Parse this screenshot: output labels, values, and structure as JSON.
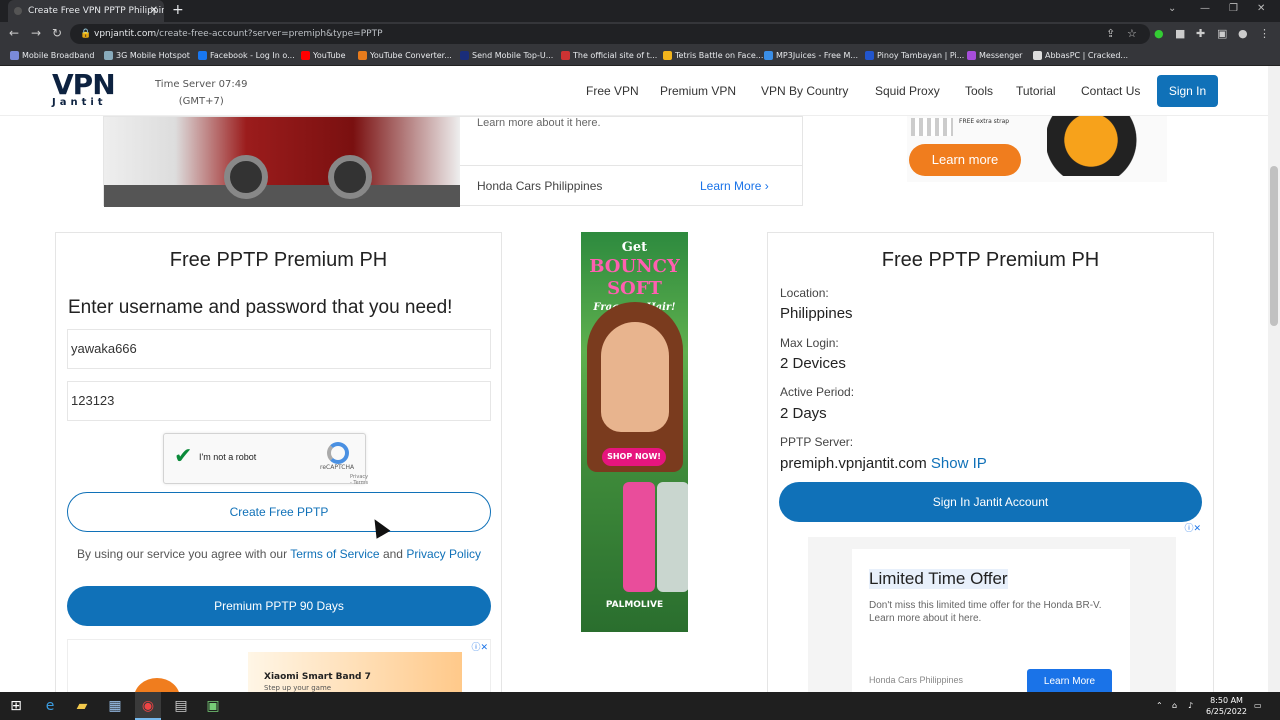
{
  "browser": {
    "tab_title": "Create Free VPN PPTP Philippine",
    "url_host": "vpnjantit.com",
    "url_path": "/create-free-account?server=premiph&type=PPTP",
    "bookmarks": [
      "Mobile Broadband",
      "3G Mobile Hotspot",
      "Facebook - Log In o...",
      "YouTube",
      "YouTube Converter...",
      "Send Mobile Top-U...",
      "The official site of t...",
      "Tetris Battle on Face...",
      "MP3Juices - Free M...",
      "Pinoy Tambayan | Pi...",
      "Messenger",
      "AbbasPC | Cracked..."
    ]
  },
  "header": {
    "logo_top": "VPN",
    "logo_bottom": "Jantit",
    "time_server": "Time Server 07:49",
    "timezone": "(GMT+7)",
    "menu": [
      "Free VPN",
      "Premium VPN",
      "VPN By Country",
      "Squid Proxy",
      "Tools",
      "Tutorial",
      "Contact Us"
    ],
    "signin": "Sign In"
  },
  "top_ad": {
    "desc": "Learn more about it here.",
    "advertiser": "Honda Cars Philippines",
    "learn_more": "Learn More",
    "right_btn": "Learn more",
    "right_small": "FREE extra strap"
  },
  "left_card": {
    "title": "Free PPTP Premium PH",
    "prompt": "Enter username and password that you need!",
    "username": "yawaka666",
    "password": "123123",
    "captcha_label": "I'm not a robot",
    "captcha_brand": "reCAPTCHA",
    "captcha_links": "Privacy - Terms",
    "create_btn": "Create Free PPTP",
    "terms_prefix": "By using our service you agree with our",
    "terms_link": "Terms of Service",
    "terms_and": "and",
    "privacy_link": "Privacy Policy",
    "premium_btn": "Premium PPTP 90 Days",
    "ad_brand": "Xiaomi Smart Band 7",
    "ad_sub": "Step up your game"
  },
  "middle_ad": {
    "line1": "Get",
    "line2": "BOUNCY",
    "line3": "SOFT",
    "line4": "Fragrant Hair!",
    "shop": "SHOP NOW!",
    "brand": "PALMOLIVE"
  },
  "right_card": {
    "title": "Free PPTP Premium PH",
    "location_label": "Location:",
    "location": "Philippines",
    "max_login_label": "Max Login:",
    "max_login": "2 Devices",
    "active_label": "Active Period:",
    "active": "2 Days",
    "server_label": "PPTP Server:",
    "server": "premiph.vpnjantit.com",
    "show_ip": "Show IP",
    "account_btn": "Sign In Jantit Account",
    "ad_heading": "Limited Time Offer",
    "ad_text": "Don't miss this limited time offer for the Honda BR-V. Learn more about it here.",
    "ad_advertiser": "Honda Cars Philippines",
    "ad_btn": "Learn More"
  },
  "taskbar": {
    "time": "8:50 AM",
    "date": "6/25/2022"
  }
}
